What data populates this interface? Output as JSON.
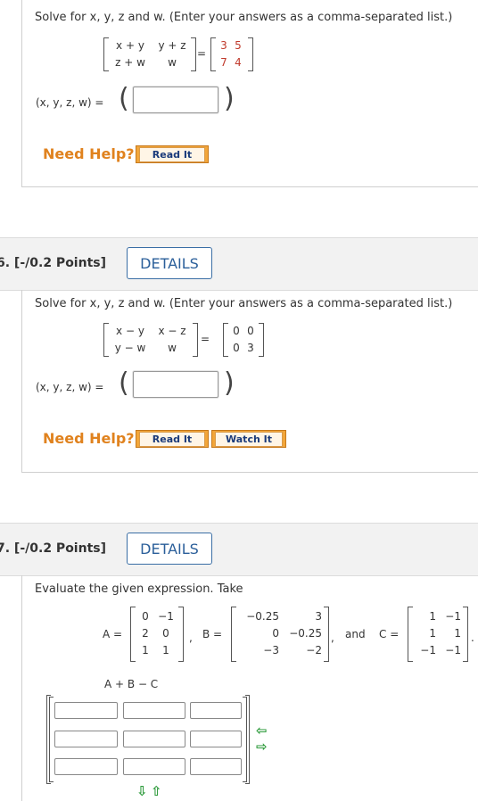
{
  "q5": {
    "prompt": "Solve for x, y, z and w. (Enter your answers as a comma-separated list.)",
    "left_matrix": [
      [
        "x + y",
        "y + z"
      ],
      [
        "z + w",
        "w"
      ]
    ],
    "right_matrix": [
      [
        "3",
        "5"
      ],
      [
        "7",
        "4"
      ]
    ],
    "equals": "=",
    "answer_label": "(x, y, z, w) =",
    "answer_value": "",
    "need_help": "Need Help?",
    "buttons": [
      "Read It"
    ]
  },
  "q6": {
    "points": "6. [-/0.2 Points]",
    "details": "DETAILS",
    "prompt": "Solve for x, y, z and w. (Enter your answers as a comma-separated list.)",
    "left_matrix": [
      [
        "x − y",
        "x − z"
      ],
      [
        "y − w",
        "w"
      ]
    ],
    "right_matrix": [
      [
        "0",
        "0"
      ],
      [
        "0",
        "3"
      ]
    ],
    "equals": "=",
    "answer_label": "(x, y, z, w) =",
    "answer_value": "",
    "need_help": "Need Help?",
    "buttons": [
      "Read It",
      "Watch It"
    ]
  },
  "q7": {
    "points": "7. [-/0.2 Points]",
    "details": "DETAILS",
    "prompt": "Evaluate the given expression. Take",
    "A_label": "A =",
    "A": [
      [
        "0",
        "−1"
      ],
      [
        "2",
        "0"
      ],
      [
        "1",
        "1"
      ]
    ],
    "B_label": "B =",
    "B": [
      [
        "−0.25",
        "3"
      ],
      [
        "0",
        "−0.25"
      ],
      [
        "−3",
        "−2"
      ]
    ],
    "and_text": "and",
    "C_label": "C =",
    "C": [
      [
        "1",
        "−1"
      ],
      [
        "1",
        "1"
      ],
      [
        "−1",
        "−1"
      ]
    ],
    "comma": ",",
    "period": ".",
    "expression": "A + B − C"
  }
}
